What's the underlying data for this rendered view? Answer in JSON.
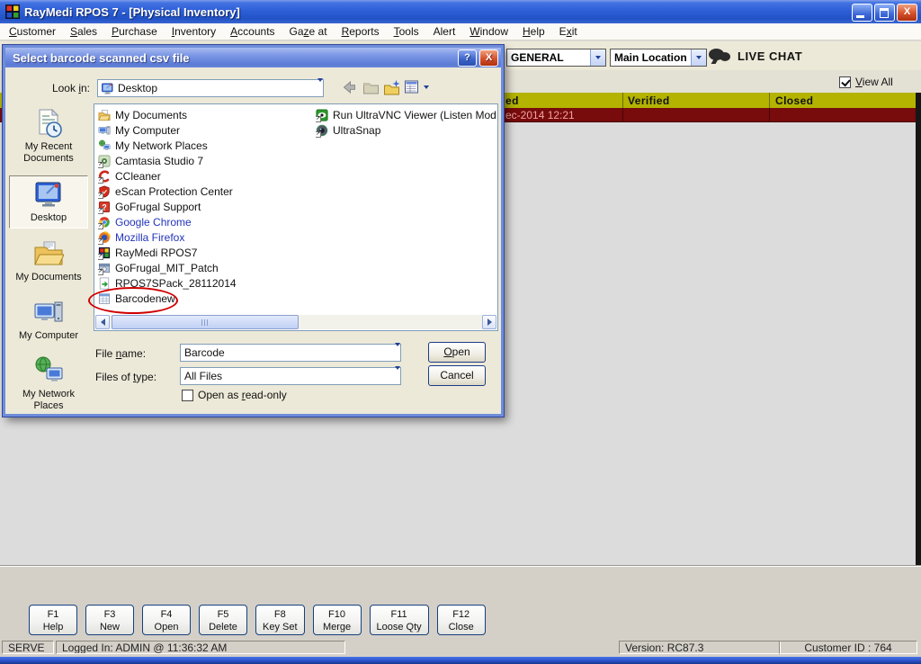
{
  "window": {
    "title": "RayMedi RPOS 7 - [Physical Inventory]",
    "controls": [
      "minimize",
      "restore",
      "close"
    ]
  },
  "menu": {
    "items": [
      {
        "label": "Customer",
        "accel": 0
      },
      {
        "label": "Sales",
        "accel": 0
      },
      {
        "label": "Purchase",
        "accel": 0
      },
      {
        "label": "Inventory",
        "accel": 0
      },
      {
        "label": "Accounts",
        "accel": 0
      },
      {
        "label": "Gaze at",
        "accel": 2
      },
      {
        "label": "Reports",
        "accel": 0
      },
      {
        "label": "Tools",
        "accel": 0
      },
      {
        "label": "Alert",
        "accel": null
      },
      {
        "label": "Window",
        "accel": 0
      },
      {
        "label": "Help",
        "accel": 0
      },
      {
        "label": "Exit",
        "accel": 1
      }
    ]
  },
  "toolbar": {
    "filters": [
      {
        "value": "GENERAL"
      },
      {
        "value": "Main Location"
      }
    ],
    "live_chat_label": "LIVE CHAT",
    "live_chat_icon": "chat-bubbles-icon"
  },
  "grid": {
    "view_all": {
      "label": "View All",
      "accel": 0,
      "checked": true
    },
    "columns": [
      {
        "label": "ed"
      },
      {
        "label": "Verified"
      },
      {
        "label": "Closed"
      }
    ],
    "rows": [
      {
        "cells": [
          "ec-2014 12:21",
          "",
          ""
        ]
      }
    ],
    "header_bg": "#b3b300",
    "row_bg": "#780b0b",
    "row_text": "#f2a3a3"
  },
  "dialog": {
    "title": "Select barcode scanned csv file",
    "help_button_icon": "question-icon",
    "close_button_icon": "close-icon",
    "look_in": {
      "label": "Look in:",
      "accel": 5,
      "value": "Desktop",
      "icon": "desktop-icon"
    },
    "toolbar_icons": [
      {
        "name": "back-arrow-icon"
      },
      {
        "name": "up-folder-icon"
      },
      {
        "name": "new-folder-icon"
      },
      {
        "name": "views-icon"
      }
    ],
    "places": [
      {
        "label": "My Recent Documents",
        "icon": "recent-documents-icon",
        "selected": false
      },
      {
        "label": "Desktop",
        "icon": "desktop-icon",
        "selected": true
      },
      {
        "label": "My Documents",
        "icon": "my-documents-icon",
        "selected": false
      },
      {
        "label": "My Computer",
        "icon": "my-computer-icon",
        "selected": false
      },
      {
        "label": "My Network Places",
        "icon": "network-places-icon",
        "selected": false
      }
    ],
    "files_col1": [
      {
        "label": "My Documents",
        "icon": "my-documents-folder-icon"
      },
      {
        "label": "My Computer",
        "icon": "my-computer-icon"
      },
      {
        "label": "My Network Places",
        "icon": "network-places-icon"
      },
      {
        "label": "Camtasia Studio 7",
        "icon": "camtasia-icon",
        "shortcut": true
      },
      {
        "label": "CCleaner",
        "icon": "ccleaner-icon",
        "shortcut": true
      },
      {
        "label": "eScan Protection Center",
        "icon": "escan-icon",
        "shortcut": true
      },
      {
        "label": "GoFrugal Support",
        "icon": "gofrugal-support-icon",
        "shortcut": true
      },
      {
        "label": "Google Chrome",
        "icon": "chrome-icon",
        "shortcut": true,
        "link": true
      },
      {
        "label": "Mozilla Firefox",
        "icon": "firefox-icon",
        "shortcut": true,
        "link": true
      },
      {
        "label": "RayMedi RPOS7",
        "icon": "raymedi-icon",
        "shortcut": true
      },
      {
        "label": "GoFrugal_MIT_Patch",
        "icon": "gofrugal-patch-icon",
        "shortcut": true
      },
      {
        "label": "RPOS7SPack_28112014",
        "icon": "rpos-pack-icon"
      },
      {
        "label": "Barcodenew",
        "icon": "csv-icon",
        "annotated": true
      }
    ],
    "files_col2": [
      {
        "label": "Run UltraVNC Viewer (Listen Mode Encr",
        "icon": "ultravnc-icon",
        "shortcut": true
      },
      {
        "label": "UltraSnap",
        "icon": "ultrasnap-icon",
        "shortcut": true
      }
    ],
    "file_name": {
      "label": "File name:",
      "accel": 5,
      "value": "Barcode"
    },
    "file_type": {
      "label": "Files of type:",
      "accel": 9,
      "value": "All Files"
    },
    "open_button": {
      "label": "Open",
      "accel": 0
    },
    "cancel_button": {
      "label": "Cancel"
    },
    "read_only": {
      "label": "Open as read-only",
      "accel": 8,
      "checked": false
    },
    "annotation_color": "#cf0000"
  },
  "function_keys": [
    {
      "key": "F1",
      "label": "Help"
    },
    {
      "key": "F3",
      "label": "New"
    },
    {
      "key": "F4",
      "label": "Open"
    },
    {
      "key": "F5",
      "label": "Delete"
    },
    {
      "key": "F8",
      "label": "Key Set"
    },
    {
      "key": "F10",
      "label": "Merge"
    },
    {
      "key": "F11",
      "label": "Loose Qty"
    },
    {
      "key": "F12",
      "label": "Close"
    }
  ],
  "status_bar": {
    "server": "SERVE",
    "logged_in": "Logged In: ADMIN @ 11:36:32 AM",
    "version": "Version: RC87.3",
    "customer_id": "Customer ID : 764"
  },
  "colors": {
    "titlebar_blue": "#2e5fd8",
    "dialog_border": "#6f8dd9",
    "grid_header": "#b3b300",
    "grid_row": "#780b0b",
    "annotation_red": "#cf0000",
    "chrome_gray": "#d4d0c8",
    "dialog_bg": "#ece9d8"
  }
}
